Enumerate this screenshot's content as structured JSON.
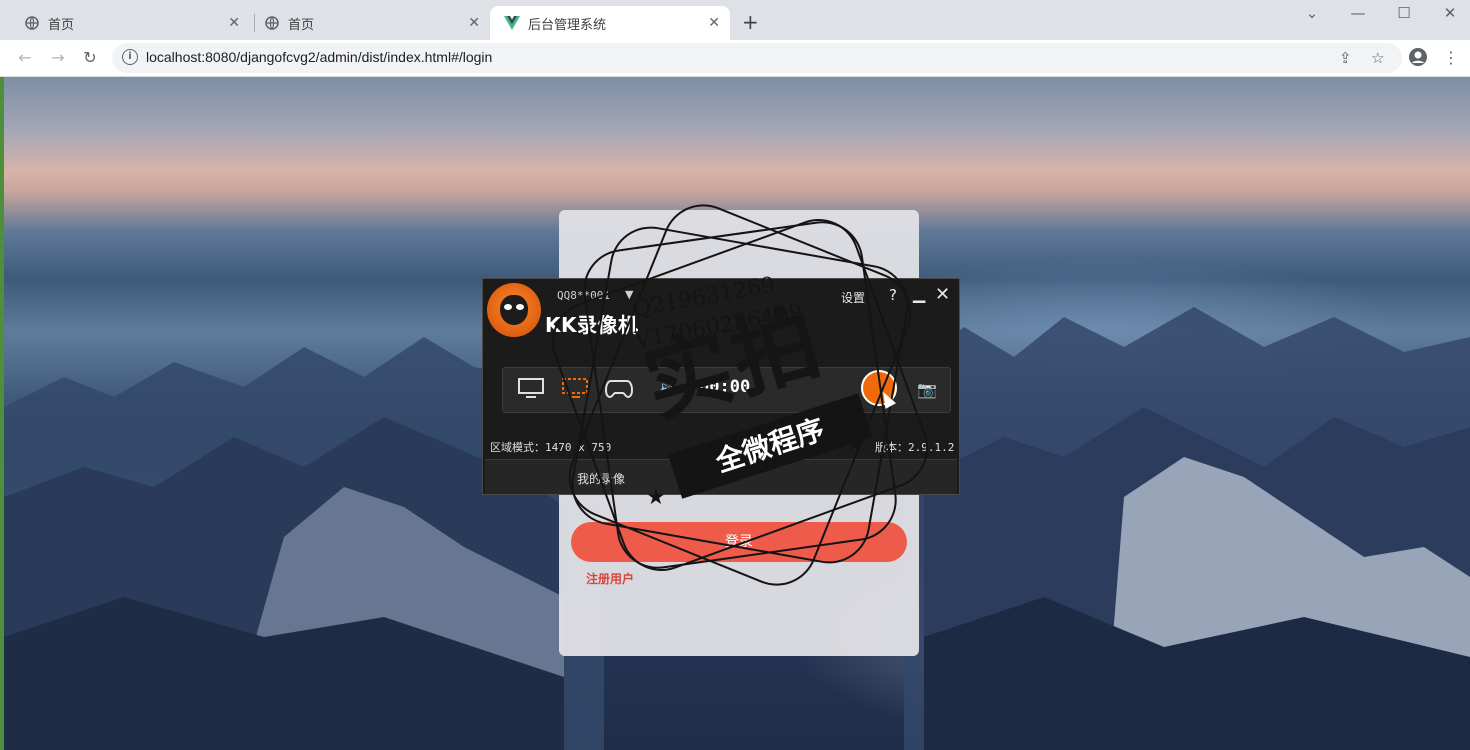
{
  "browser": {
    "tabs": [
      {
        "title": "首页",
        "active": false
      },
      {
        "title": "首页",
        "active": false
      },
      {
        "title": "后台管理系统",
        "active": true
      }
    ],
    "url": "localhost:8080/djangofcvg2/admin/dist/index.html#/login"
  },
  "login": {
    "login_button": "登录",
    "register_link": "注册用户"
  },
  "kk_recorder": {
    "app_name": "KK录像机",
    "account": "QQ8**001",
    "settings_label": "设置",
    "help_label": "?",
    "timer": "00:00",
    "region_mode": "区域模式：1470 x 750",
    "version": "版本：2.9.1.2",
    "my_recordings": "我的录像"
  },
  "watermark": {
    "line1": "Q219631269",
    "line2": "V17060256499",
    "big_text": "实拍",
    "banner": "全微程序"
  },
  "colors": {
    "accent_login": "#ee5b4a",
    "register_link": "#d9453a",
    "record_button": "#f06a0a",
    "kk_background": "#1b1b1b"
  }
}
